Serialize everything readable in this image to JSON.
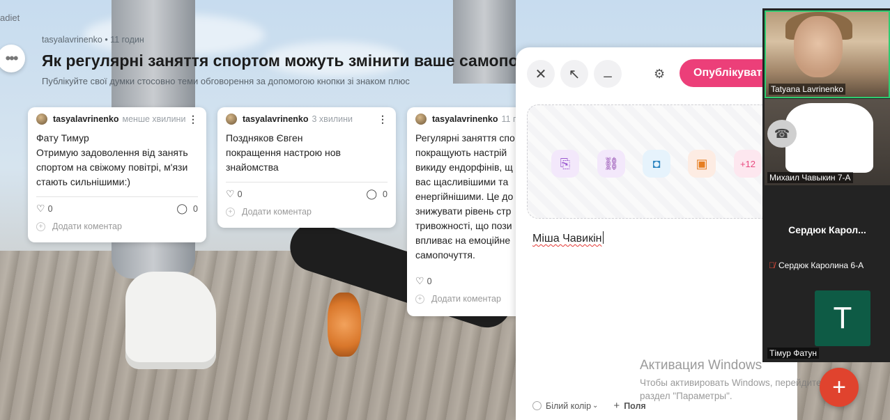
{
  "brand": "adiet",
  "header": {
    "author": "tasyalavrinenko",
    "time": "11 годин",
    "title": "Як регулярні заняття спортом можуть змінити ваше самопочуття",
    "subtitle": "Публікуйте свої думки стосовно теми обговорення за допомогою кнопки зі знаком плюс"
  },
  "cards": [
    {
      "author": "tasyalavrinenko",
      "time": "менше хвилини",
      "body": "Фату Тимур\nОтримую задоволення від занять спортом на свіжому повітрі, м'язи стають сильнішими:)",
      "likes": "0",
      "comments": "0",
      "add_comment": "Додати коментар"
    },
    {
      "author": "tasyalavrinenko",
      "time": "3 хвилини",
      "body": "Поздняков Євген\nпокращення настрою нов знайомства",
      "likes": "0",
      "comments": "0",
      "add_comment": "Додати коментар"
    },
    {
      "author": "tasyalavrinenko",
      "time": "11 го",
      "body": "Регулярні заняття спо покращують настрій викиду ендорфінів, щ вас щасливішими та енергійнішими. Це до знижувати рівень стр тривожності, що пози впливає на емоційне самопочуття.",
      "likes": "0",
      "add_comment": "Додати коментар"
    }
  ],
  "composer": {
    "publish_label": "Опублікувати",
    "attach_more": "+12",
    "typed_text": "Міша Чавикін",
    "color_option": "Білий колір",
    "fields_label": "Поля"
  },
  "watermark": {
    "title": "Активация Windows",
    "text": "Чтобы активировать Windows, перейдите в раздел \"Параметры\"."
  },
  "call": {
    "participants": [
      {
        "name": "Tatyana Lavrinenko"
      },
      {
        "name": "Михаил Чавыкин 7-А"
      },
      {
        "name": "Сердюк Карол...",
        "label": "Сердюк Каролина 6-А"
      },
      {
        "name": "Тімур Фатун",
        "initial": "T"
      }
    ]
  }
}
